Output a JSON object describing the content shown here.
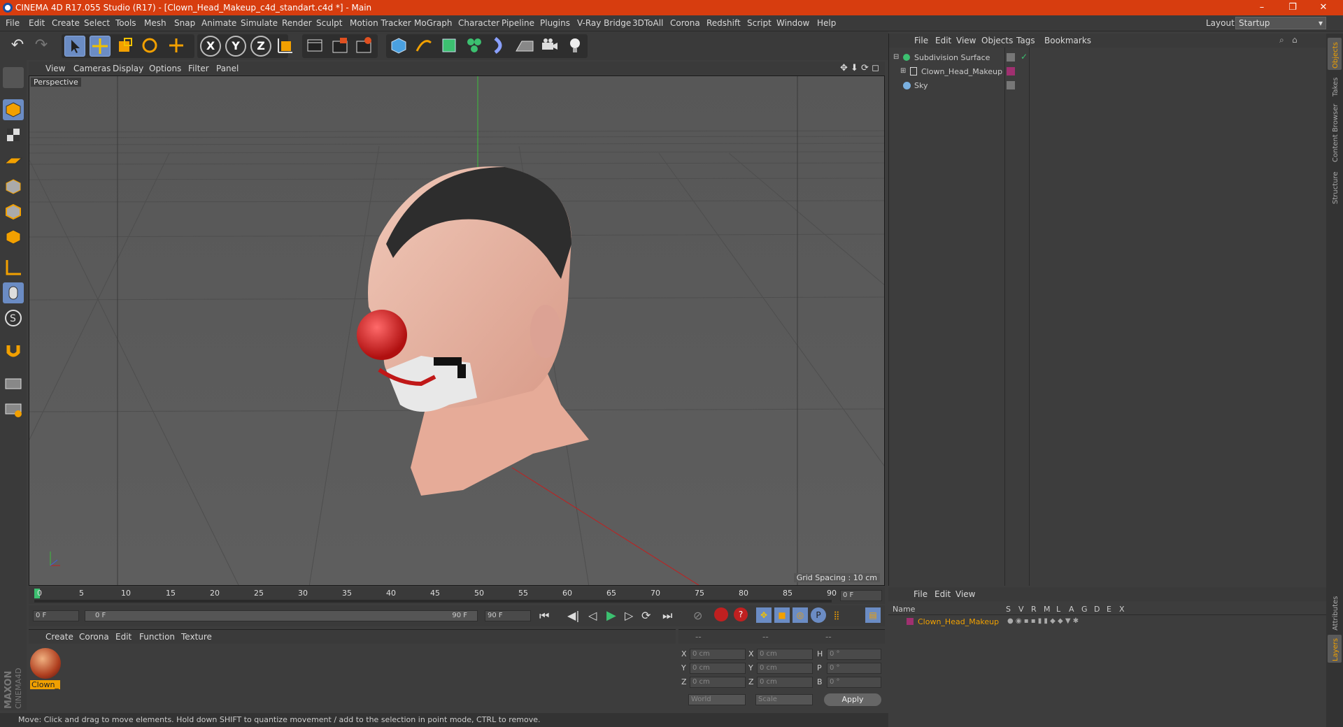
{
  "window": {
    "title": "CINEMA 4D R17.055 Studio (R17) - [Clown_Head_Makeup_c4d_standart.c4d *] - Main",
    "controls": [
      "–",
      "❐",
      "✕"
    ]
  },
  "menubar": {
    "items": [
      "File",
      "Edit",
      "Create",
      "Select",
      "Tools",
      "Mesh",
      "Snap",
      "Animate",
      "Simulate",
      "Render",
      "Sculpt",
      "Motion Tracker",
      "MoGraph",
      "Character",
      "Pipeline",
      "Plugins",
      "V-Ray Bridge",
      "3DToAll",
      "Corona",
      "Redshift",
      "Script",
      "Window",
      "Help"
    ],
    "layout_label": "Layout:",
    "layout_value": "Startup"
  },
  "toolbar": {
    "axis_x": "X",
    "axis_y": "Y",
    "axis_z": "Z"
  },
  "viewport": {
    "menu": [
      "View",
      "Cameras",
      "Display",
      "Options",
      "Filter",
      "Panel"
    ],
    "label": "Perspective",
    "grid_spacing": "Grid Spacing : 10 cm"
  },
  "object_manager": {
    "menu": [
      "File",
      "Edit",
      "View",
      "Objects",
      "Tags",
      "Bookmarks"
    ],
    "objects": [
      {
        "name": "Subdivision Surface"
      },
      {
        "name": "Clown_Head_Makeup"
      },
      {
        "name": "Sky"
      }
    ]
  },
  "timeline": {
    "ticks": [
      "0",
      "5",
      "10",
      "15",
      "20",
      "25",
      "30",
      "35",
      "40",
      "45",
      "50",
      "55",
      "60",
      "65",
      "70",
      "75",
      "80",
      "85",
      "90"
    ],
    "current_frame_box": "0 F",
    "start_field": "0 F",
    "range_start": "0 F",
    "range_end": "90 F",
    "end_field": "90 F"
  },
  "material_manager": {
    "menu": [
      "Create",
      "Corona",
      "Edit",
      "Function",
      "Texture"
    ],
    "materials": [
      {
        "name": "Clown_"
      }
    ]
  },
  "coordinates": {
    "headers": [
      "--",
      "--",
      "--"
    ],
    "rows": [
      {
        "axis": "X",
        "pos": "0 cm",
        "axis2": "X",
        "size": "0 cm",
        "axis3": "H",
        "rot": "0 °"
      },
      {
        "axis": "Y",
        "pos": "0 cm",
        "axis2": "Y",
        "size": "0 cm",
        "axis3": "P",
        "rot": "0 °"
      },
      {
        "axis": "Z",
        "pos": "0 cm",
        "axis2": "Z",
        "size": "0 cm",
        "axis3": "B",
        "rot": "0 °"
      }
    ],
    "mode": "World",
    "scale_mode": "Scale",
    "apply": "Apply"
  },
  "layer_manager": {
    "menu": [
      "File",
      "Edit",
      "View"
    ],
    "header": "Name",
    "flags": [
      "S",
      "V",
      "R",
      "M",
      "L",
      "A",
      "G",
      "D",
      "E",
      "X"
    ],
    "row": "Clown_Head_Makeup"
  },
  "side_tabs": [
    "Objects",
    "Takes",
    "Content Browser",
    "Structure",
    "Attributes",
    "Layers"
  ],
  "status": "Move: Click and drag to move elements. Hold down SHIFT to quantize movement / add to the selection in point mode, CTRL to remove.",
  "logo_text": "MAXON CINEMA4D",
  "colors": {
    "titlebar": "#d73d0f",
    "accent": "#6b8cc4",
    "material_label": "#f0a000"
  }
}
